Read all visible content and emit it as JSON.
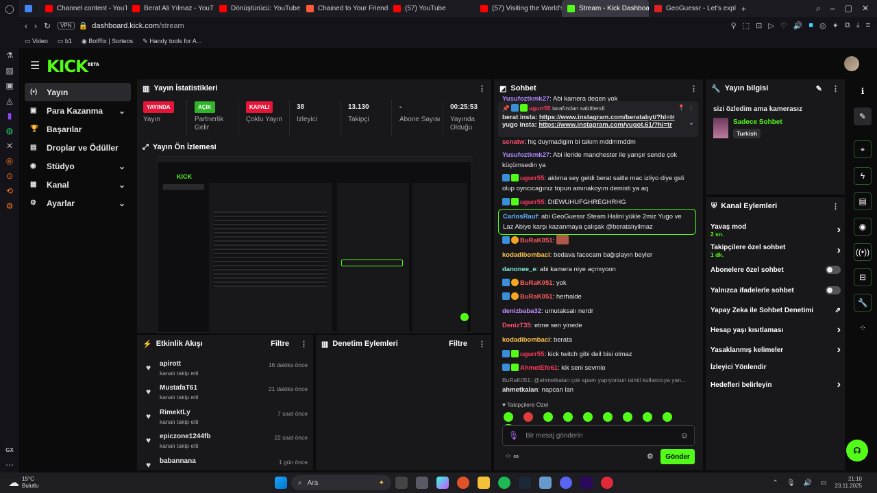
{
  "browser": {
    "tabs": [
      {
        "label": "Channel content - YouTub",
        "color": "#ff0000"
      },
      {
        "label": "Berat Ali Yılmaz - YouTub",
        "color": "#ff0000"
      },
      {
        "label": "Dönüştürücü: YouTube M",
        "color": "#ff0000"
      },
      {
        "label": "Chained to Your Friends",
        "color": "#ff5a36"
      },
      {
        "label": "(57) YouTube",
        "color": "#ff0000"
      },
      {
        "label": "(57) Visiting the World's",
        "color": "#ff0000"
      },
      {
        "label": "Stream - Kick Dashboard",
        "color": "#53fc18"
      },
      {
        "label": "GeoGuessr - Let's explore",
        "color": "#e02020"
      }
    ],
    "vpn": "VPN",
    "url_domain": "dashboard.kick.com",
    "url_path": "/stream",
    "bookmarks": [
      "Video",
      "b1",
      "BotRix | Sorteos",
      "Handy tools for A..."
    ]
  },
  "kick": {
    "logo": "KICK",
    "logo_beta": "BETA",
    "nav": [
      {
        "label": "Yayın",
        "icon": "(•)"
      },
      {
        "label": "Para Kazanma",
        "icon": "▣",
        "chev": "⌄"
      },
      {
        "label": "Başarılar",
        "icon": "🏆"
      },
      {
        "label": "Droplar ve Ödüller",
        "icon": "▤"
      },
      {
        "label": "Stüdyo",
        "icon": "◉",
        "chev": "⌄"
      },
      {
        "label": "Kanal",
        "icon": "▦",
        "chev": "⌄"
      },
      {
        "label": "Ayarlar",
        "icon": "⚙",
        "chev": "⌄"
      }
    ],
    "stats_title": "Yayın İstatistikleri",
    "stats": [
      {
        "value": "YAYINDA",
        "label": "Yayın",
        "badge": "#e4163a"
      },
      {
        "value": "AÇIK",
        "label": "Partnerlik Gelir",
        "badge": "#2fb52a"
      },
      {
        "value": "KAPALI",
        "label": "Çoklu Yayın",
        "badge": "#e4163a"
      },
      {
        "value": "38",
        "label": "İzleyici"
      },
      {
        "value": "13.130",
        "label": "Takipçi"
      },
      {
        "value": "-",
        "label": "Abone Sayısı"
      },
      {
        "value": "00:25:53",
        "label": "Yayında Olduğu"
      }
    ],
    "preview_title": "Yayın Ön İzlemesi",
    "activity_title": "Etkinlik Akışı",
    "activity_filter": "Filtre",
    "moderation_title": "Denetim Eylemleri",
    "moderation_filter": "Filtre",
    "activity": [
      {
        "name": "apirott",
        "sub": "kanalı takip etti",
        "time": "16 dakika önce"
      },
      {
        "name": "MustafaT61",
        "sub": "kanalı takip etti",
        "time": "21 dakika önce"
      },
      {
        "name": "RimektLy",
        "sub": "kanalı takip etti",
        "time": "7 saat önce"
      },
      {
        "name": "epiczone1244fb",
        "sub": "kanalı takip etti",
        "time": "22 saat önce"
      },
      {
        "name": "babannana",
        "sub": "",
        "time": "1 gün önce"
      }
    ],
    "chat_title": "Sohbet",
    "pinned": {
      "user": "ugurr55",
      "by": "tarafından sabitlendi",
      "line1_label": "berat insta:",
      "line1_link": "https://www.instagram.com/beratalıyt/?hl=tr",
      "line2_label": "yugo insta:",
      "line2_link": "https://www.instagram.com/yugot.61/?hl=tr"
    },
    "chat": [
      {
        "user": "Yusufoztkmk27",
        "color": "#b08cff",
        "text": "Abi kamera degen yok"
      },
      {
        "user": "senatw",
        "color": "#ff4f6b",
        "text": "hiç duymadigim bi takım mddmmddm"
      },
      {
        "user": "Yusufoztkmk27",
        "color": "#b08cff",
        "text": "Abi ileride manchester ile yarışır sende çok küçümsedin ya"
      },
      {
        "user": "ugurr55",
        "color": "#ff3b5c",
        "text": "aklıma sey geldi berat saitle mac izliyo diye gsli olup oyncıcagınız topun amınakoyım demisti ya aq"
      },
      {
        "user": "ugurr55",
        "color": "#ff3b5c",
        "text": "DIEWUHUFGHREGHRHG"
      },
      {
        "user": "CarlosRauf",
        "color": "#5fb7ff",
        "text": "abi GeoGuessr Steam Halini yükle 2miz Yugo ve Laz Abiye karşı kazanmaya çalışak @beratalıyilmaz"
      },
      {
        "user": "BuRaK051",
        "color": "#ff5a5a",
        "text": ""
      },
      {
        "user": "kodadibombaci",
        "color": "#ffc44d",
        "text": "bedava facecam bağışlayın beyler"
      },
      {
        "user": "danonee_e",
        "color": "#7ff0d6",
        "text": "abi kamera niye açmıyoon"
      },
      {
        "user": "BuRaK051",
        "color": "#ff5a5a",
        "text": "yok"
      },
      {
        "user": "BuRaK051",
        "color": "#ff5a5a",
        "text": "herhalde"
      },
      {
        "user": "denizbaba32",
        "color": "#c58cff",
        "text": "umutaksalı nerdr"
      },
      {
        "user": "DenizT35",
        "color": "#ff4f6b",
        "text": "etme sen yinede"
      },
      {
        "user": "kodadibombaci",
        "color": "#ffc44d",
        "text": "berata"
      },
      {
        "user": "ugurr55",
        "color": "#ff3b5c",
        "text": "kick twitch gibi deil bisi olmaz"
      },
      {
        "user": "AhmetEfe61",
        "color": "#ff3b5c",
        "text": "kik seni sevmio"
      },
      {
        "user": "ahmetkalan",
        "color": "#e8e8e8",
        "text": "napcan lan"
      }
    ],
    "reply_preview": "BuRaK051: @ahmetkalan çok spam yapıyorsun isimli kullanıcıya yan...",
    "followers_only": "Takipçilere Özel",
    "chat_placeholder": "Bir mesaj gönderin",
    "send_label": "Gönder",
    "info_title": "Yayın bilgisi",
    "info_stream_title": "sizi özledim ama kamerasız",
    "info_category": "Sadece Sohbet",
    "info_language": "Turkish",
    "actions_title": "Kanal Eylemleri",
    "actions": [
      {
        "label": "Yavaş mod",
        "sub": "2 sn.",
        "kind": "chev"
      },
      {
        "label": "Takipçilere özel sohbet",
        "sub": "1 dk.",
        "kind": "chev"
      },
      {
        "label": "Abonelere özel sohbet",
        "kind": "toggle"
      },
      {
        "label": "Yalnızca ifadelerle sohbet",
        "kind": "toggle"
      },
      {
        "label": "Yapay Zeka ile Sohbet Denetimi",
        "kind": "ext"
      },
      {
        "label": "Hesap yaşı kısıtlaması",
        "kind": "chev"
      },
      {
        "label": "Yasaklanmış kelimeler",
        "kind": "chev"
      },
      {
        "label": "İzleyici Yönlendir",
        "kind": "none"
      },
      {
        "label": "Hedefleri belirleyin",
        "kind": "chev"
      }
    ]
  },
  "taskbar": {
    "temp": "15°C",
    "weather": "Bulutlu",
    "search": "Ara",
    "time": "21:10",
    "date": "23.11.2025",
    "gx": "GX"
  }
}
